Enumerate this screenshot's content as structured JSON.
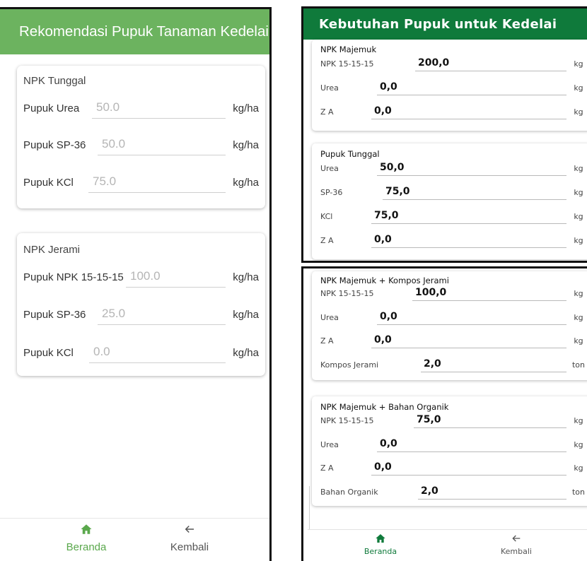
{
  "left_app": {
    "header_title": "Rekomendasi Pupuk Tanaman Kedelai",
    "npk_tunggal": {
      "title": "NPK Tunggal",
      "rows": [
        {
          "label": "Pupuk Urea",
          "value": "50.0",
          "unit": "kg/ha"
        },
        {
          "label": "Pupuk SP-36",
          "value": "50.0",
          "unit": "kg/ha"
        },
        {
          "label": "Pupuk KCl",
          "value": "75.0",
          "unit": "kg/ha"
        }
      ]
    },
    "npk_jerami": {
      "title": "NPK Jerami",
      "rows": [
        {
          "label": "Pupuk NPK 15-15-15",
          "value": "100.0",
          "unit": "kg/ha"
        },
        {
          "label": "Pupuk SP-36",
          "value": "25.0",
          "unit": "kg/ha"
        },
        {
          "label": "Pupuk KCl",
          "value": "0.0",
          "unit": "kg/ha"
        }
      ]
    },
    "nav": {
      "home_label": "Beranda",
      "back_label": "Kembali",
      "home_icon": "home-icon",
      "back_icon": "arrow-left-icon"
    },
    "colors": {
      "header": "#6cb35f",
      "nav_active": "#5aa84c"
    }
  },
  "right_app": {
    "header_title": "Kebutuhan Pupuk untuk Kedelai",
    "npk_majemuk": {
      "title": "NPK Majemuk",
      "rows": [
        {
          "label": "NPK 15-15-15",
          "value": "200,0",
          "unit": "kg"
        },
        {
          "label": "Urea",
          "value": "0,0",
          "unit": "kg"
        },
        {
          "label": "Z A",
          "value": "0,0",
          "unit": "kg"
        }
      ]
    },
    "pupuk_tunggal": {
      "title": "Pupuk Tunggal",
      "rows": [
        {
          "label": "Urea",
          "value": "50,0",
          "unit": "kg"
        },
        {
          "label": "SP-36",
          "value": "75,0",
          "unit": "kg"
        },
        {
          "label": "KCl",
          "value": "75,0",
          "unit": "kg"
        },
        {
          "label": "Z A",
          "value": "0,0",
          "unit": "kg"
        }
      ]
    },
    "majemuk_kompos": {
      "title": "NPK Majemuk + Kompos Jerami",
      "rows": [
        {
          "label": "NPK 15-15-15",
          "value": "100,0",
          "unit": "kg"
        },
        {
          "label": "Urea",
          "value": "0,0",
          "unit": "kg"
        },
        {
          "label": "Z A",
          "value": "0,0",
          "unit": "kg"
        },
        {
          "label": "Kompos Jerami",
          "value": "2,0",
          "unit": "ton"
        }
      ]
    },
    "majemuk_organik": {
      "title": "NPK Majemuk + Bahan Organik",
      "rows": [
        {
          "label": "NPK 15-15-15",
          "value": "75,0",
          "unit": "kg"
        },
        {
          "label": "Urea",
          "value": "0,0",
          "unit": "kg"
        },
        {
          "label": "Z A",
          "value": "0,0",
          "unit": "kg"
        },
        {
          "label": "Bahan Organik",
          "value": "2,0",
          "unit": "ton"
        }
      ]
    },
    "nav": {
      "home_label": "Beranda",
      "back_label": "Kembali",
      "home_icon": "home-icon",
      "back_icon": "arrow-left-icon"
    },
    "colors": {
      "header": "#0f7a3b",
      "nav_active": "#0f7a3b"
    }
  }
}
